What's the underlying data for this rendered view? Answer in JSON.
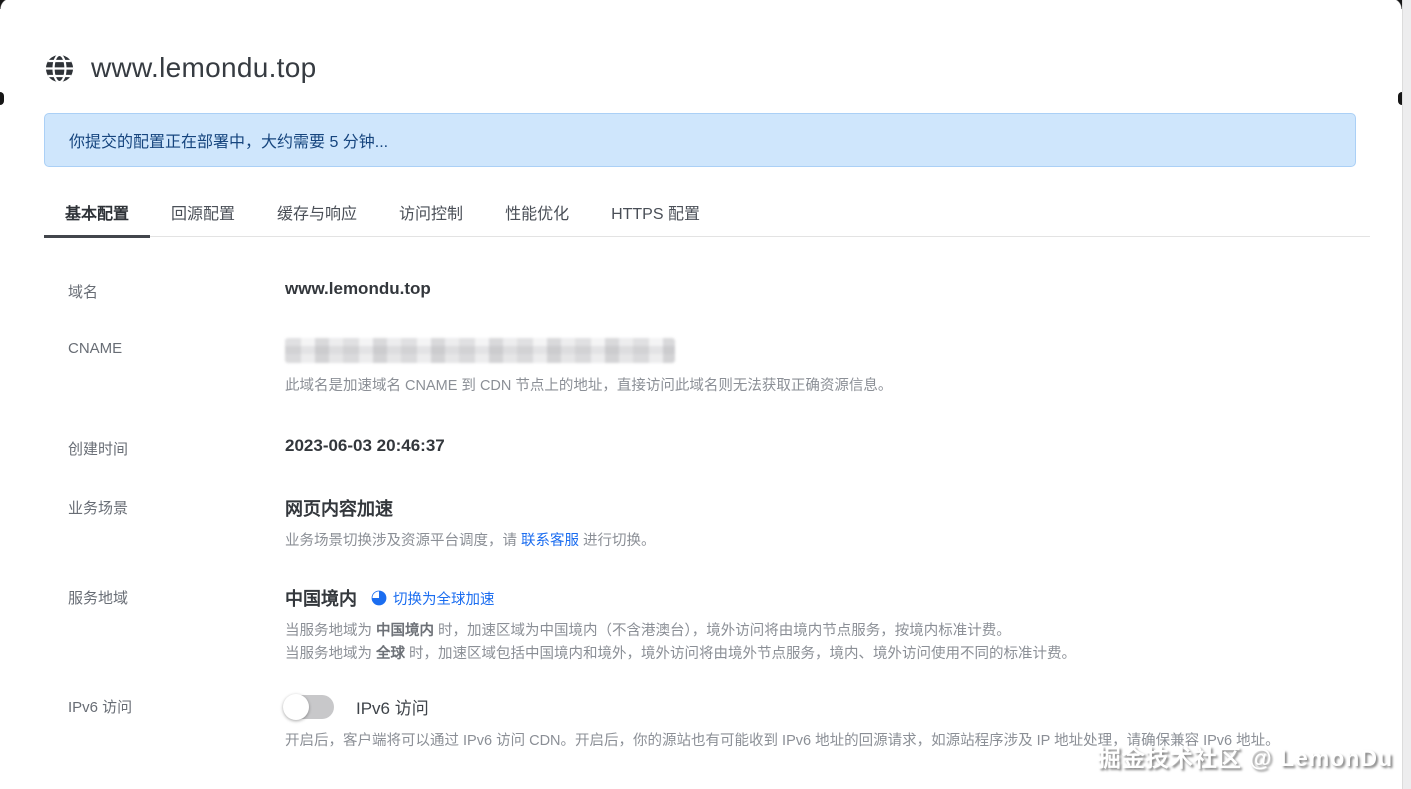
{
  "header": {
    "title": "www.lemondu.top",
    "icon": "globe-icon"
  },
  "alert": {
    "message": "你提交的配置正在部署中，大约需要 5 分钟..."
  },
  "tabs": [
    {
      "label": "基本配置",
      "active": true
    },
    {
      "label": "回源配置",
      "active": false
    },
    {
      "label": "缓存与响应",
      "active": false
    },
    {
      "label": "访问控制",
      "active": false
    },
    {
      "label": "性能优化",
      "active": false
    },
    {
      "label": "HTTPS 配置",
      "active": false
    }
  ],
  "form": {
    "domain": {
      "label": "域名",
      "value": "www.lemondu.top"
    },
    "cname": {
      "label": "CNAME",
      "value_state": "redacted",
      "description": "此域名是加速域名 CNAME 到 CDN 节点上的地址，直接访问此域名则无法获取正确资源信息。"
    },
    "created": {
      "label": "创建时间",
      "value": "2023-06-03 20:46:37"
    },
    "scenario": {
      "label": "业务场景",
      "value": "网页内容加速",
      "desc_prefix": "业务场景切换涉及资源平台调度，请 ",
      "desc_link": "联系客服",
      "desc_suffix": " 进行切换。"
    },
    "region": {
      "label": "服务地域",
      "value": "中国境内",
      "switch_link": "切换为全球加速",
      "desc1_prefix": "当服务地域为 ",
      "desc1_bold": "中国境内",
      "desc1_suffix": " 时，加速区域为中国境内（不含港澳台），境外访问将由境内节点服务，按境内标准计费。",
      "desc2_prefix": "当服务地域为 ",
      "desc2_bold": "全球",
      "desc2_suffix": " 时，加速区域包括中国境内和境外，境外访问将由境外节点服务，境内、境外访问使用不同的标准计费。"
    },
    "ipv6": {
      "label": "IPv6 访问",
      "toggle_label": "IPv6 访问",
      "toggle_state": "off",
      "description": "开启后，客户端将可以通过 IPv6 访问 CDN。开启后，你的源站也有可能收到 IPv6 地址的回源请求，如源站程序涉及 IP 地址处理，请确保兼容 IPv6 地址。"
    }
  },
  "watermark": "掘金技术社区 @ LemonDu",
  "colors": {
    "link_blue": "#1b6df0",
    "alert_bg": "#cfe6fc",
    "alert_border": "#abd0f6",
    "alert_text": "#16457e",
    "active_tab_underline": "#42464c",
    "toggle_off_track": "#c8c8ca"
  }
}
